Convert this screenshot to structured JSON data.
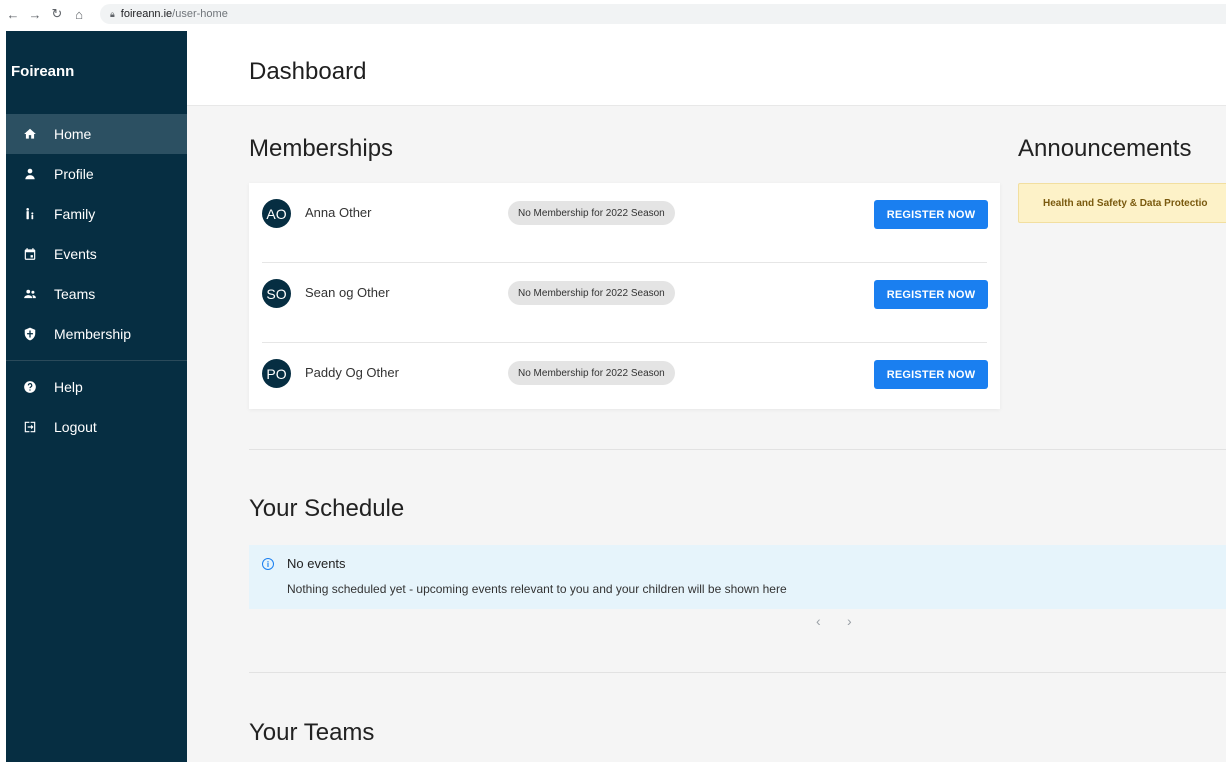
{
  "browser": {
    "back": "←",
    "forward": "→",
    "reload": "↻",
    "home": "⌂",
    "url_host": "foireann.ie",
    "url_path": "/user-home"
  },
  "sidebar": {
    "brand": "Foireann",
    "items": [
      {
        "label": "Home",
        "icon": "home-icon",
        "active": true
      },
      {
        "label": "Profile",
        "icon": "person-icon"
      },
      {
        "label": "Family",
        "icon": "family-icon"
      },
      {
        "label": "Events",
        "icon": "calendar-icon"
      },
      {
        "label": "Teams",
        "icon": "group-icon"
      },
      {
        "label": "Membership",
        "icon": "shield-icon"
      }
    ],
    "bottom_items": [
      {
        "label": "Help",
        "icon": "help-icon"
      },
      {
        "label": "Logout",
        "icon": "logout-icon"
      }
    ]
  },
  "header": {
    "title": "Dashboard"
  },
  "memberships": {
    "title": "Memberships",
    "members": [
      {
        "initials": "AO",
        "name": "Anna Other",
        "status": "No Membership for 2022 Season",
        "action": "REGISTER NOW"
      },
      {
        "initials": "SO",
        "name": "Sean og Other",
        "status": "No Membership for 2022 Season",
        "action": "REGISTER NOW"
      },
      {
        "initials": "PO",
        "name": "Paddy Og Other",
        "status": "No Membership for 2022 Season",
        "action": "REGISTER NOW"
      }
    ]
  },
  "announcements": {
    "title": "Announcements",
    "items": [
      "Health and Safety & Data Protectio"
    ]
  },
  "schedule": {
    "title": "Your Schedule",
    "empty_title": "No events",
    "empty_text": "Nothing scheduled yet - upcoming events relevant to you and your children will be shown here",
    "prev": "‹",
    "next": "›"
  },
  "teams": {
    "title": "Your Teams"
  },
  "colors": {
    "sidebar_bg": "#062e42",
    "sidebar_active": "#2c5062",
    "primary_button": "#1a7ff0",
    "announcement_bg": "#fdf2c8",
    "info_bg": "#e6f4fb"
  }
}
